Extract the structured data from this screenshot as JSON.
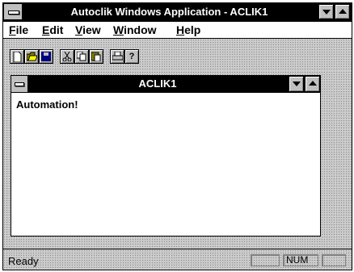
{
  "window": {
    "title": "Autoclik Windows Application - ACLIK1",
    "buttons": [
      "minimize",
      "maximize"
    ]
  },
  "menu": {
    "items": [
      {
        "label": "File",
        "mnemonic": "F"
      },
      {
        "label": "Edit",
        "mnemonic": "E"
      },
      {
        "label": "View",
        "mnemonic": "V"
      },
      {
        "label": "Window",
        "mnemonic": "W"
      },
      {
        "label": "Help",
        "mnemonic": "H"
      }
    ]
  },
  "toolbar": {
    "buttons": [
      {
        "icon": "new-file-icon"
      },
      {
        "icon": "open-folder-icon"
      },
      {
        "icon": "save-disk-icon"
      },
      {
        "icon": "cut-scissors-icon"
      },
      {
        "icon": "copy-icon"
      },
      {
        "icon": "paste-icon"
      },
      {
        "icon": "print-icon"
      },
      {
        "icon": "help-question-icon",
        "label": "?"
      }
    ]
  },
  "child_window": {
    "title": "ACLIK1",
    "content_text": "Automation!"
  },
  "status": {
    "text": "Ready",
    "indicators": [
      "",
      "NUM",
      ""
    ]
  },
  "colors": {
    "titlebar": "#000000",
    "chrome": "#c0c0c0",
    "client": "#ffffff"
  }
}
